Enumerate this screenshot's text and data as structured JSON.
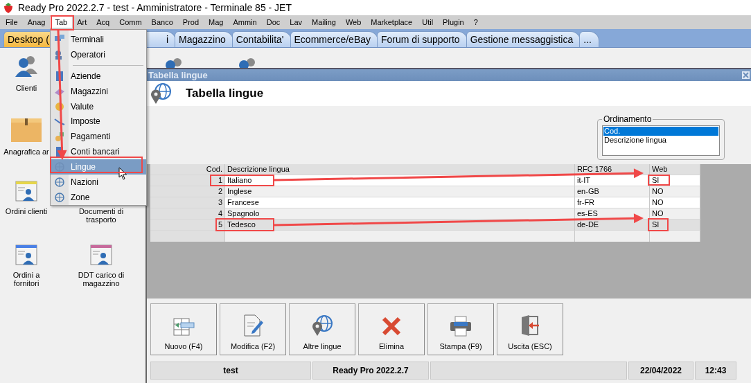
{
  "window": {
    "title": "Ready Pro 2022.2.7 - test - Amministratore - Terminale 85 - JET"
  },
  "menu_bar": [
    {
      "label": "File",
      "selected": false
    },
    {
      "label": "Anag",
      "selected": false
    },
    {
      "label": "Tab",
      "selected": true
    },
    {
      "label": "Art",
      "selected": false
    },
    {
      "label": "Acq",
      "selected": false
    },
    {
      "label": "Comm",
      "selected": false
    },
    {
      "label": "Banco",
      "selected": false
    },
    {
      "label": "Prod",
      "selected": false
    },
    {
      "label": "Mag",
      "selected": false
    },
    {
      "label": "Ammin",
      "selected": false
    },
    {
      "label": "Doc",
      "selected": false
    },
    {
      "label": "Lav",
      "selected": false
    },
    {
      "label": "Mailing",
      "selected": false
    },
    {
      "label": "Web",
      "selected": false
    },
    {
      "label": "Marketplace",
      "selected": false
    },
    {
      "label": "Util",
      "selected": false
    },
    {
      "label": "Plugin",
      "selected": false
    },
    {
      "label": "?",
      "selected": false
    }
  ],
  "dropdown_menu": [
    {
      "kind": "item",
      "label": "Terminali",
      "selected": false
    },
    {
      "kind": "item",
      "label": "Operatori",
      "selected": false
    },
    {
      "kind": "separator"
    },
    {
      "kind": "item",
      "label": "Aziende",
      "selected": false
    },
    {
      "kind": "item",
      "label": "Magazzini",
      "selected": false
    },
    {
      "kind": "item",
      "label": "Valute",
      "selected": false
    },
    {
      "kind": "item",
      "label": "Imposte",
      "selected": false
    },
    {
      "kind": "item",
      "label": "Pagamenti",
      "selected": false
    },
    {
      "kind": "item",
      "label": "Conti bancari",
      "selected": false
    },
    {
      "kind": "item",
      "label": "Lingue",
      "selected": true
    },
    {
      "kind": "item",
      "label": "Nazioni",
      "selected": false
    },
    {
      "kind": "item",
      "label": "Zone",
      "selected": false
    }
  ],
  "tabs": [
    {
      "label": "Desktop (",
      "selected": true
    },
    {
      "label": "i",
      "selected": false
    },
    {
      "label": "Magazzino",
      "selected": false
    },
    {
      "label": "Contabilita'",
      "selected": false
    },
    {
      "label": "Ecommerce/eBay",
      "selected": false
    },
    {
      "label": "Forum di supporto",
      "selected": false
    },
    {
      "label": "Gestione messaggistica",
      "selected": false
    },
    {
      "label": "...",
      "selected": false
    }
  ],
  "desktop": {
    "rows": [
      [
        {
          "label": "Clienti"
        }
      ],
      [
        {
          "label": "Anagrafica ar"
        }
      ],
      [
        {
          "label": "Ordini clienti",
          "color": "#e6d64a"
        },
        {
          "label": "Documenti di trasporto"
        }
      ],
      [
        {
          "label": "Ordini a fornitori",
          "color": "#4a80e6"
        },
        {
          "label": "DDT carico di magazzino",
          "color": "#c76a9c"
        }
      ]
    ]
  },
  "dialog": {
    "title": "Tabella lingue",
    "heading": "Tabella lingue",
    "sort_group": {
      "label": "Ordinamento",
      "options": [
        {
          "label": "Cod.",
          "selected": true
        },
        {
          "label": "Descrizione lingua",
          "selected": false
        }
      ]
    },
    "table": {
      "columns": [
        "Cod.",
        "Descrizione lingua",
        "RFC 1766",
        "Web"
      ],
      "rows": [
        {
          "cells": [
            "1",
            "Italiano",
            "it-IT",
            "SI"
          ],
          "selected": false
        },
        {
          "cells": [
            "2",
            "Inglese",
            "en-GB",
            "NO"
          ],
          "selected": false
        },
        {
          "cells": [
            "3",
            "Francese",
            "fr-FR",
            "NO"
          ],
          "selected": false
        },
        {
          "cells": [
            "4",
            "Spagnolo",
            "es-ES",
            "NO"
          ],
          "selected": false
        },
        {
          "cells": [
            "5",
            "Tedesco",
            "de-DE",
            "SI"
          ],
          "selected": true
        }
      ]
    },
    "buttons": [
      "Nuovo (F4)",
      "Modifica (F2)",
      "Altre lingue",
      "Elimina",
      "Stampa (F9)",
      "Uscita (ESC)"
    ],
    "status_bar": [
      {
        "kind": "text",
        "text": "test"
      },
      {
        "kind": "text",
        "text": "Ready Pro 2022.2.7"
      },
      {
        "kind": "spacer"
      },
      {
        "kind": "text",
        "text": "22/04/2022"
      },
      {
        "kind": "text",
        "text": "12:43"
      }
    ]
  }
}
